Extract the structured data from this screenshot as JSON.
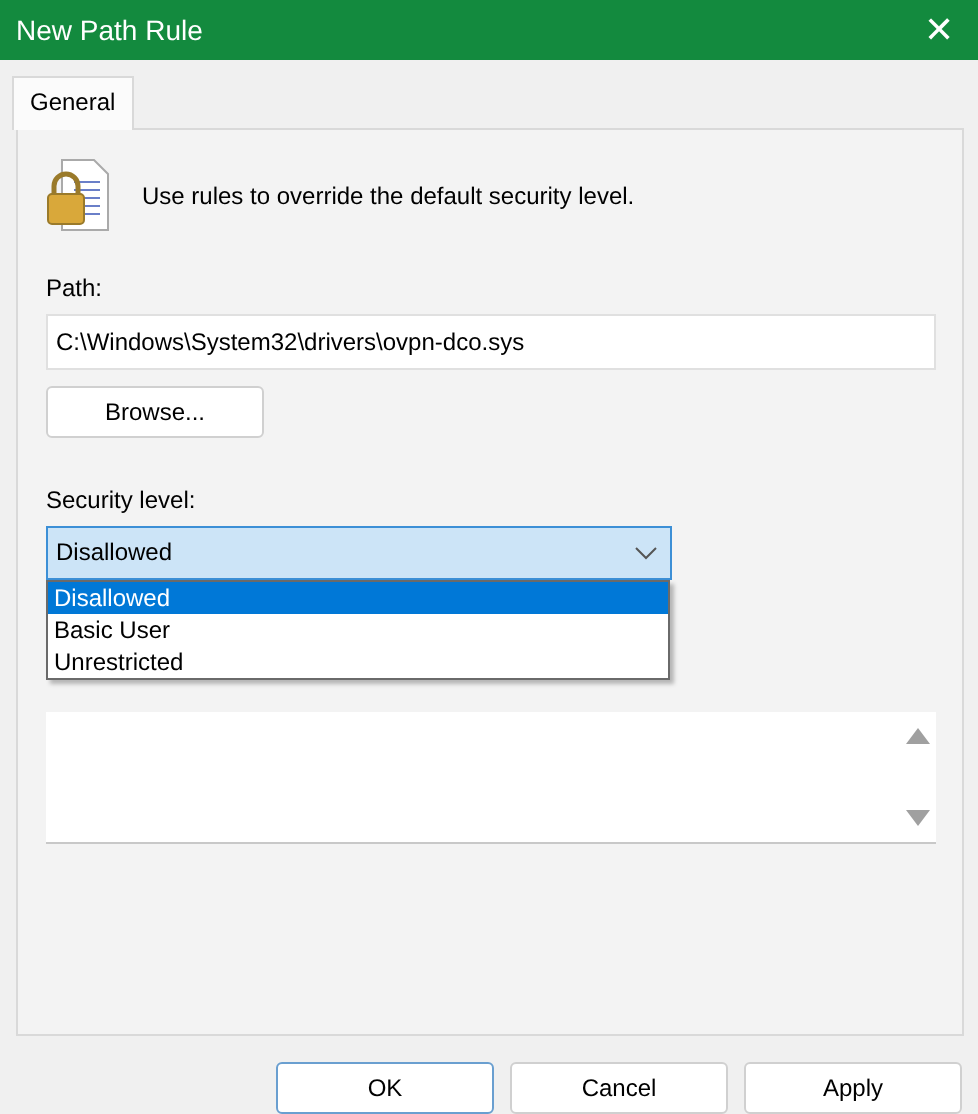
{
  "window": {
    "title": "New Path Rule",
    "close": "✕"
  },
  "tabs": [
    {
      "label": "General",
      "selected": true
    }
  ],
  "intro": "Use rules to override the default security level.",
  "path": {
    "label": "Path:",
    "value": "C:\\Windows\\System32\\drivers\\ovpn-dco.sys"
  },
  "browse_button": "Browse...",
  "security_level": {
    "label": "Security level:",
    "value": "Disallowed",
    "expanded": true,
    "options": [
      {
        "label": "Disallowed",
        "selected": true
      },
      {
        "label": "Basic User",
        "selected": false
      },
      {
        "label": "Unrestricted",
        "selected": false
      }
    ]
  },
  "buttons": [
    {
      "label": "OK",
      "default": true
    },
    {
      "label": "Cancel",
      "default": false
    },
    {
      "label": "Apply",
      "default": false
    }
  ]
}
